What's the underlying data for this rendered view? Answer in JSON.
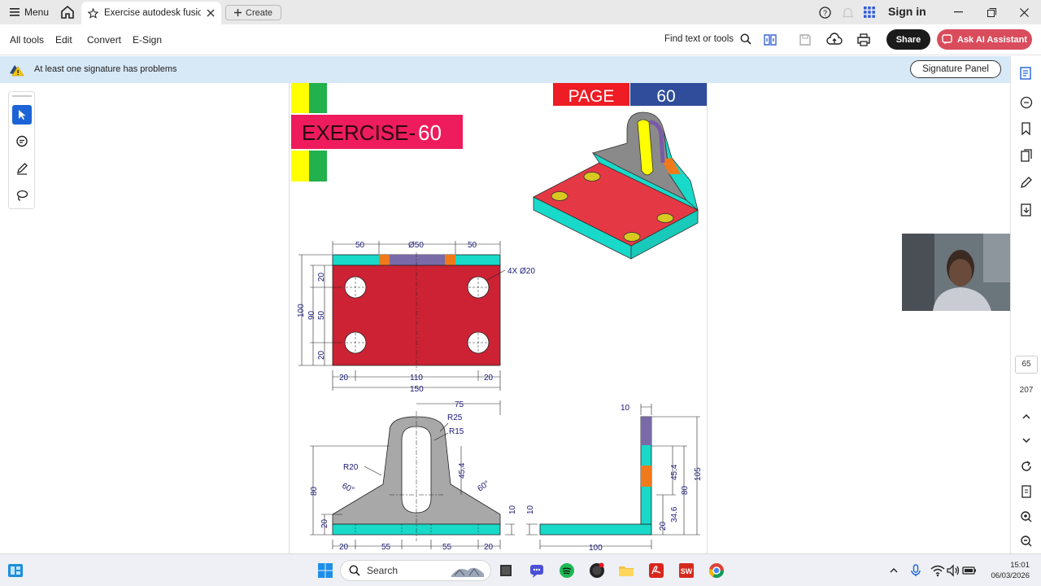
{
  "titlebar": {
    "menu_label": "Menu",
    "tab_title": "Exercise autodesk fusion...",
    "create_label": "Create",
    "sign_in": "Sign in"
  },
  "toolbar": {
    "all_tools": "All tools",
    "edit": "Edit",
    "convert": "Convert",
    "esign": "E-Sign",
    "find": "Find text or tools",
    "share": "Share",
    "ask_ai": "Ask AI Assistant"
  },
  "signature_bar": {
    "message": "At least one signature has problems",
    "panel_button": "Signature Panel"
  },
  "document": {
    "page_label": "PAGE",
    "page_number": "60",
    "exercise_label": "EXERCISE-",
    "exercise_number": "60",
    "dims": {
      "d50a": "50",
      "d_dia50": "Ø50",
      "d50b": "50",
      "holes": "4X Ø20",
      "d100": "100",
      "d90": "90",
      "d50v": "50",
      "d20a": "20",
      "d20b": "20",
      "d20c": "20",
      "d110": "110",
      "d20d": "20",
      "d150": "150",
      "d75": "75",
      "r25": "R25",
      "r15": "R15",
      "r20": "R20",
      "d45_4": "45.4",
      "d80": "80",
      "a60a": "60°",
      "a60b": "60°",
      "d20e": "20",
      "d10a": "10",
      "d10b": "10",
      "d20f": "20",
      "d55a": "55",
      "d55b": "55",
      "d20g": "20",
      "s10": "10",
      "s100": "100",
      "s105": "105",
      "s80": "80",
      "s45_4": "45.4",
      "s34_6": "34.6",
      "s20": "20"
    }
  },
  "rightrail": {
    "current_page": "65",
    "total_pages": "207"
  },
  "taskbar": {
    "search": "Search",
    "time": "15:01",
    "date": "06/03/2026"
  },
  "colors": {
    "accent_red": "#d94c5c",
    "part_red": "#cc2233",
    "part_cyan": "#19d9c9",
    "part_gray": "#a8a8a8",
    "sigbar_blue": "#d7e8f7"
  }
}
